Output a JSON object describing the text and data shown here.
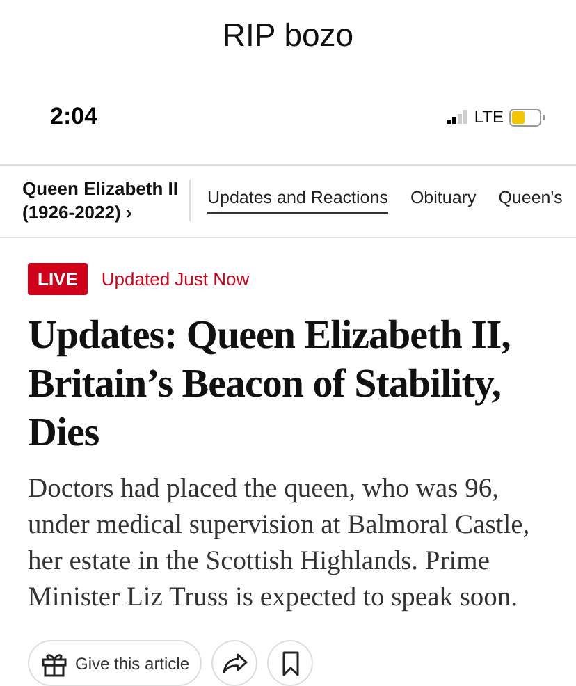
{
  "caption": "RIP bozo",
  "status_bar": {
    "time": "2:04",
    "network": "LTE"
  },
  "section_nav": {
    "title": "Queen Elizabeth II (1926-2022) ›",
    "tabs": [
      {
        "label": "Updates and Reactions",
        "selected": true
      },
      {
        "label": "Obituary",
        "selected": false
      },
      {
        "label": "Queen's",
        "selected": false
      }
    ]
  },
  "article": {
    "badge": "LIVE",
    "updated": "Updated Just Now",
    "headline": "Updates: Queen Elizabeth II, Britain’s Beacon of Stability, Dies",
    "summary": "Doctors had placed the queen, who was 96, under medical supervision at Balmoral Castle, her estate in the Scottish Highlands. Prime Minister Liz Truss is expected to speak soon."
  },
  "actions": {
    "gift_button": "Give this article"
  }
}
